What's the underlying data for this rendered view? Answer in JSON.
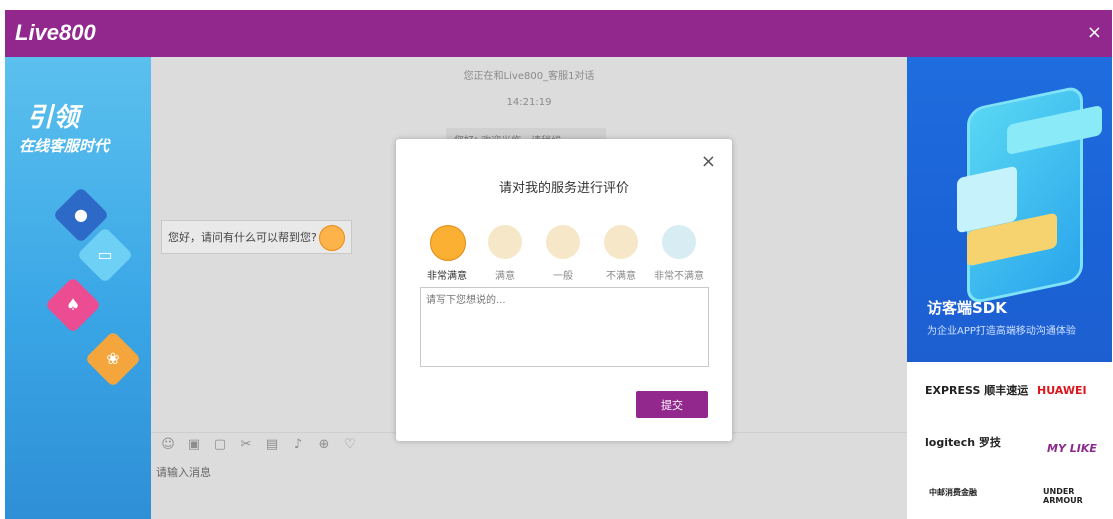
{
  "header": {
    "logo": "Live800",
    "close": "×"
  },
  "left_banner": {
    "line1": "引领",
    "line2": "在线客服时代"
  },
  "chat": {
    "status": "您正在和Live800_客服1对话",
    "time": "14:21:19",
    "greeting_partial": "您好! 欢迎光临，请稍候",
    "agent_message": "您好，请问有什么可以帮到您?",
    "input_placeholder": "请输入消息"
  },
  "toolbar_icons": [
    "emoji-icon",
    "image-icon",
    "file-icon",
    "screenshot-icon",
    "save-icon",
    "sound-icon",
    "globe-icon",
    "heart-icon"
  ],
  "rating_dialog": {
    "close": "×",
    "title": "请对我的服务进行评价",
    "options": [
      {
        "label": "非常满意",
        "selected": true
      },
      {
        "label": "满意",
        "selected": false
      },
      {
        "label": "一般",
        "selected": false
      },
      {
        "label": "不满意",
        "selected": false
      },
      {
        "label": "非常不满意",
        "selected": false
      }
    ],
    "comment_placeholder": "请写下您想说的...",
    "submit": "提交"
  },
  "right_banner": {
    "title": "访客端SDK",
    "subtitle": "为企业APP打造高端移动沟通体验"
  },
  "partner_logos": [
    "EXPRESS 顺丰速运",
    "HUAWEI",
    "logitech 罗技",
    "MY LIKE",
    "中邮消费金融",
    "UNDER ARMOUR"
  ],
  "colors": {
    "brand": "#92288e",
    "sdk_blue": "#1a63d7"
  }
}
